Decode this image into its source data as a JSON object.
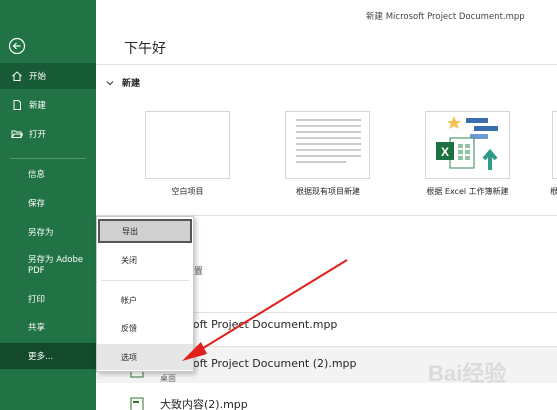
{
  "window": {
    "title": "新建 Microsoft Project Document.mpp"
  },
  "sidebar": {
    "items": [
      {
        "label": "开始",
        "icon": "home-icon"
      },
      {
        "label": "新建",
        "icon": "new-document-icon"
      },
      {
        "label": "打开",
        "icon": "open-folder-icon"
      },
      {
        "label": "信息"
      },
      {
        "label": "保存"
      },
      {
        "label": "另存为"
      },
      {
        "label": "另存为 Adobe PDF"
      },
      {
        "label": "打印"
      },
      {
        "label": "共享"
      },
      {
        "label": "更多..."
      }
    ]
  },
  "main": {
    "greeting": "下午好",
    "new_section": {
      "title": "新建"
    },
    "templates": [
      {
        "caption": "空白项目"
      },
      {
        "caption": "根据现有项目新建"
      },
      {
        "caption": "根据 Excel 工作簿新建"
      },
      {
        "caption": "根"
      }
    ],
    "recent": [
      {
        "name": "licrosoft Project Document.mpp",
        "location": ""
      },
      {
        "name": "licrosoft Project Document (2).mpp",
        "location": "桌面"
      },
      {
        "name": "大致内容(2).mpp",
        "location": ""
      }
    ],
    "recent_partial_char": "置"
  },
  "more_menu": {
    "items": [
      "导出",
      "关闭",
      "帐户",
      "反馈",
      "选项"
    ],
    "selected": "导出",
    "hovered": "选项"
  },
  "watermark": {
    "text": "Bai经验"
  },
  "colors": {
    "sidebar": "#217346",
    "sidebar_active": "#185c37",
    "arrow": "#e0201a"
  }
}
